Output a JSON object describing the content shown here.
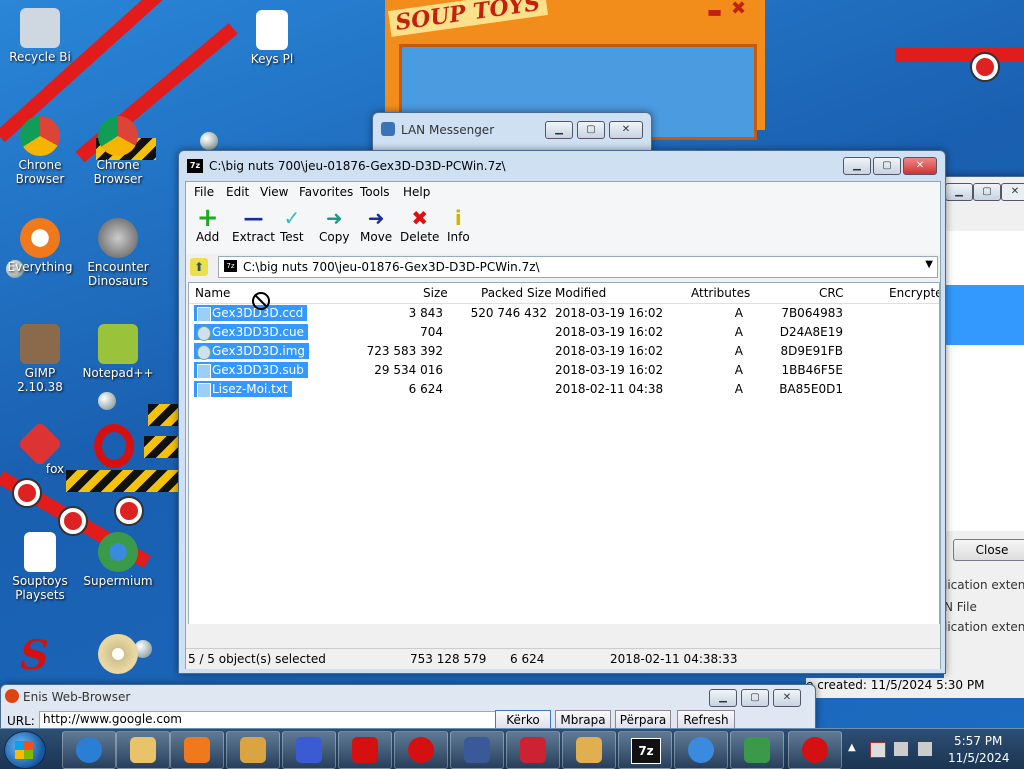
{
  "desktop": {
    "icons": [
      {
        "label": "Recycle Bi",
        "color": "#cfd8e0"
      },
      {
        "label": "Keys Pl",
        "color": "#ffffff"
      },
      {
        "label": "Chrone Browser",
        "color": "#e8b22a"
      },
      {
        "label": "Chrone Browser",
        "color": "#e8b22a"
      },
      {
        "label": "Everything",
        "color": "#f07a1b"
      },
      {
        "label": "Encounter Dinosaurs",
        "color": "#777777"
      },
      {
        "label": "GIMP 2.10.38",
        "color": "#8a6a4a"
      },
      {
        "label": "Notepad++",
        "color": "#9ac23a"
      },
      {
        "label": "fox",
        "color": "#d33"
      },
      {
        "label": "Souptoys Playsets",
        "color": "#ffffff"
      },
      {
        "label": "Supermium",
        "color": "#3a9a4a"
      }
    ]
  },
  "lan_messenger": {
    "title": "LAN Messenger"
  },
  "zip_window": {
    "title": "C:\\big nuts 700\\jeu-01876-Gex3D-D3D-PCWin.7z\\",
    "app_icon": "7z",
    "menu": [
      "File",
      "Edit",
      "View",
      "Favorites",
      "Tools",
      "Help"
    ],
    "toolbar": [
      {
        "label": "Add",
        "icon": "+",
        "color": "#1faa1f"
      },
      {
        "label": "Extract",
        "icon": "—",
        "color": "#1a2aa0"
      },
      {
        "label": "Test",
        "icon": "✓",
        "color": "#2bbfbf"
      },
      {
        "label": "Copy",
        "icon": "➜",
        "color": "#1a9a8a"
      },
      {
        "label": "Move",
        "icon": "➜",
        "color": "#1a2aa0"
      },
      {
        "label": "Delete",
        "icon": "✖",
        "color": "#d11"
      },
      {
        "label": "Info",
        "icon": "i",
        "color": "#d2b400"
      }
    ],
    "address": "C:\\big nuts 700\\jeu-01876-Gex3D-D3D-PCWin.7z\\",
    "columns": [
      "Name",
      "Size",
      "Packed Size",
      "Modified",
      "Attributes",
      "CRC",
      "Encrypte"
    ],
    "rows": [
      {
        "name": "Gex3DD3D.ccd",
        "size": "3 843",
        "packed": "520 746 432",
        "modified": "2018-03-19 16:02",
        "attr": "A",
        "crc": "7B064983"
      },
      {
        "name": "Gex3DD3D.cue",
        "size": "704",
        "packed": "",
        "modified": "2018-03-19 16:02",
        "attr": "A",
        "crc": "D24A8E19"
      },
      {
        "name": "Gex3DD3D.img",
        "size": "723 583 392",
        "packed": "",
        "modified": "2018-03-19 16:02",
        "attr": "A",
        "crc": "8D9E91FB"
      },
      {
        "name": "Gex3DD3D.sub",
        "size": "29 534 016",
        "packed": "",
        "modified": "2018-03-19 16:02",
        "attr": "A",
        "crc": "1BB46F5E"
      },
      {
        "name": "Lisez-Moi.txt",
        "size": "6 624",
        "packed": "",
        "modified": "2018-02-11 04:38",
        "attr": "A",
        "crc": "BA85E0D1"
      }
    ],
    "status": {
      "selected": "5 / 5 object(s) selected",
      "total_size": "753 128 579",
      "sel_size": "6 624",
      "date": "2018-02-11 04:38:33"
    }
  },
  "right_dialog": {
    "close_label": "Close",
    "lines": [
      "lication extens.",
      "N File",
      "lication extens."
    ],
    "date_created": "e created:  11/5/2024 5:30 PM"
  },
  "browser": {
    "title": "Enis Web-Browser",
    "url_label": "URL:",
    "url": "http://www.google.com",
    "buttons": [
      "Kërko",
      "Mbrapa",
      "Përpara",
      "Refresh"
    ]
  },
  "soup": {
    "logo": "SOUP TOYS"
  },
  "taskbar": {
    "time": "5:57 PM",
    "date": "11/5/2024",
    "apps": [
      {
        "name": "ie",
        "color": "#2a7fd4"
      },
      {
        "name": "explorer",
        "color": "#e8c36a"
      },
      {
        "name": "media",
        "color": "#f07a1b"
      },
      {
        "name": "paint",
        "color": "#d9a441"
      },
      {
        "name": "bird",
        "color": "#3a5bd4"
      },
      {
        "name": "souptoys",
        "color": "#d41010"
      },
      {
        "name": "opera",
        "color": "#d41010"
      },
      {
        "name": "facebook",
        "color": "#3b5998"
      },
      {
        "name": "game",
        "color": "#c23"
      },
      {
        "name": "paint2",
        "color": "#e0b050"
      },
      {
        "name": "7zip",
        "color": "#111111"
      },
      {
        "name": "chrome",
        "color": "#3a8ae0"
      },
      {
        "name": "messenger",
        "color": "#3a9a4a"
      },
      {
        "name": "apple",
        "color": "#d41010"
      }
    ]
  }
}
